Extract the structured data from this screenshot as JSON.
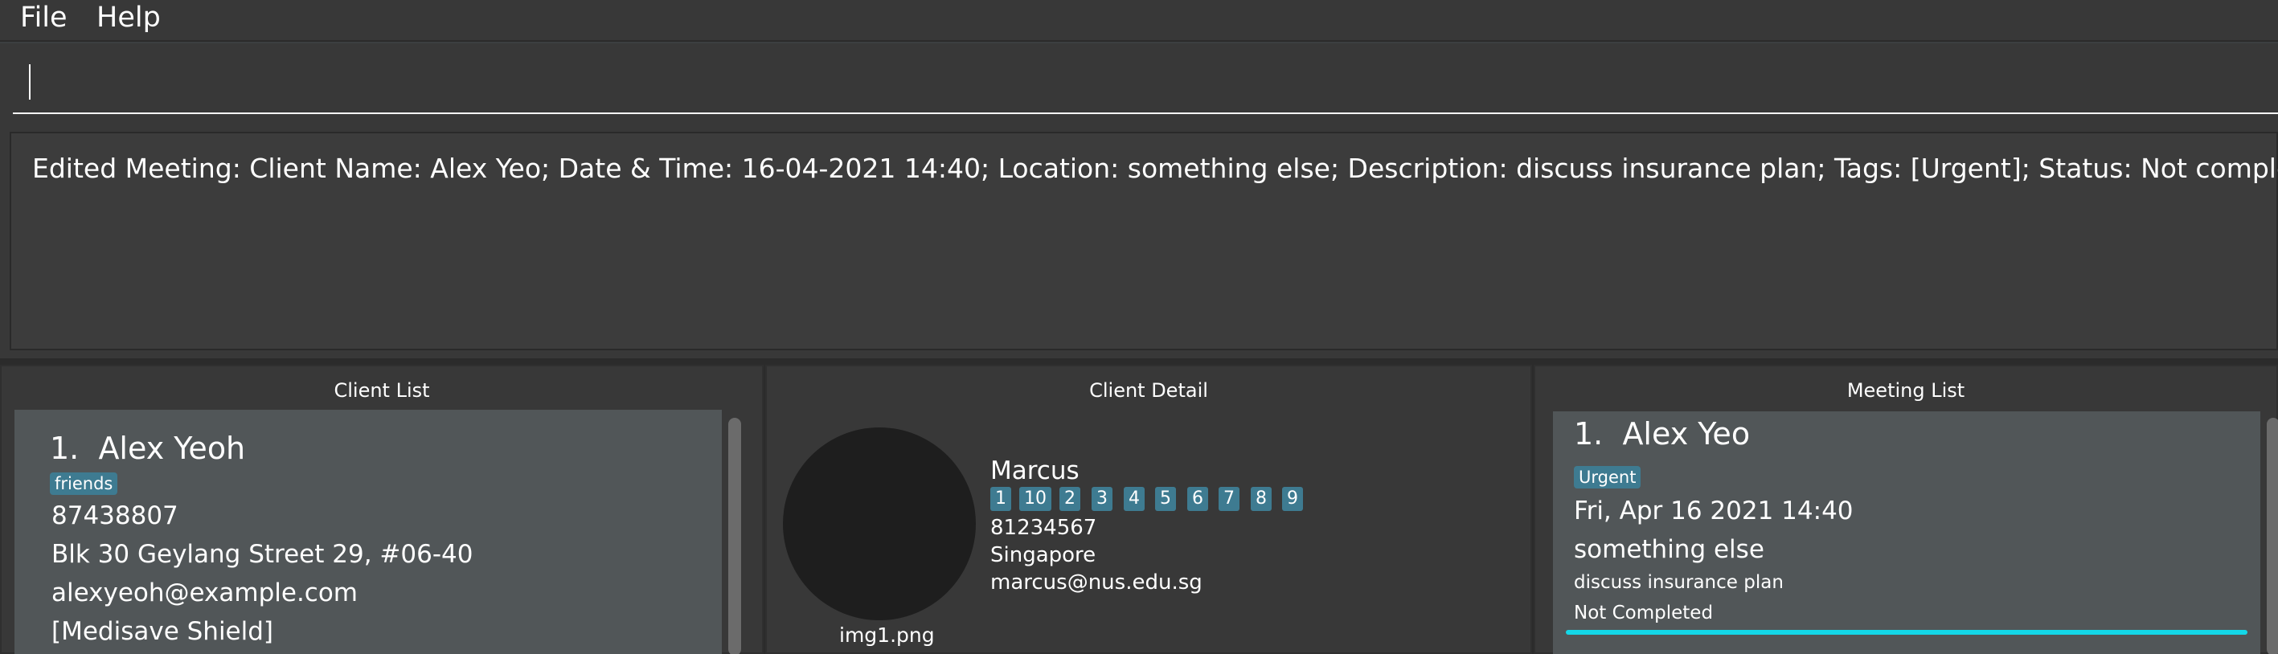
{
  "menu": {
    "file": "File",
    "help": "Help"
  },
  "command": {
    "value": "",
    "placeholder": ""
  },
  "result": {
    "text": "Edited Meeting: Client Name: Alex Yeo; Date & Time: 16-04-2021 14:40; Location: something else; Description: discuss insurance plan; Tags: [Urgent]; Status: Not completed"
  },
  "client_list": {
    "title": "Client List",
    "clients": [
      {
        "index": "1.",
        "name": "Alex Yeoh",
        "tags": [
          "friends"
        ],
        "phone": "87438807",
        "address": "Blk 30 Geylang Street 29, #06-40",
        "email": "alexyeoh@example.com",
        "policies": "[Medisave Shield]"
      }
    ]
  },
  "client_detail": {
    "title": "Client Detail",
    "image_label": "img1.png",
    "name": "Marcus",
    "tags": [
      "1",
      "10",
      "2",
      "3",
      "4",
      "5",
      "6",
      "7",
      "8",
      "9"
    ],
    "phone": "81234567",
    "address": "Singapore",
    "email": "marcus@nus.edu.sg"
  },
  "meeting_list": {
    "title": "Meeting List",
    "meetings": [
      {
        "index": "1.",
        "client_name": "Alex Yeo",
        "tags": [
          "Urgent"
        ],
        "datetime": "Fri, Apr 16 2021 14:40",
        "location": "something else",
        "description": "discuss insurance plan",
        "status": "Not Completed"
      }
    ]
  },
  "colors": {
    "background": "#383838",
    "card": "#515658",
    "tag": "#3e7b91",
    "status_bar": "#14d7e8"
  }
}
